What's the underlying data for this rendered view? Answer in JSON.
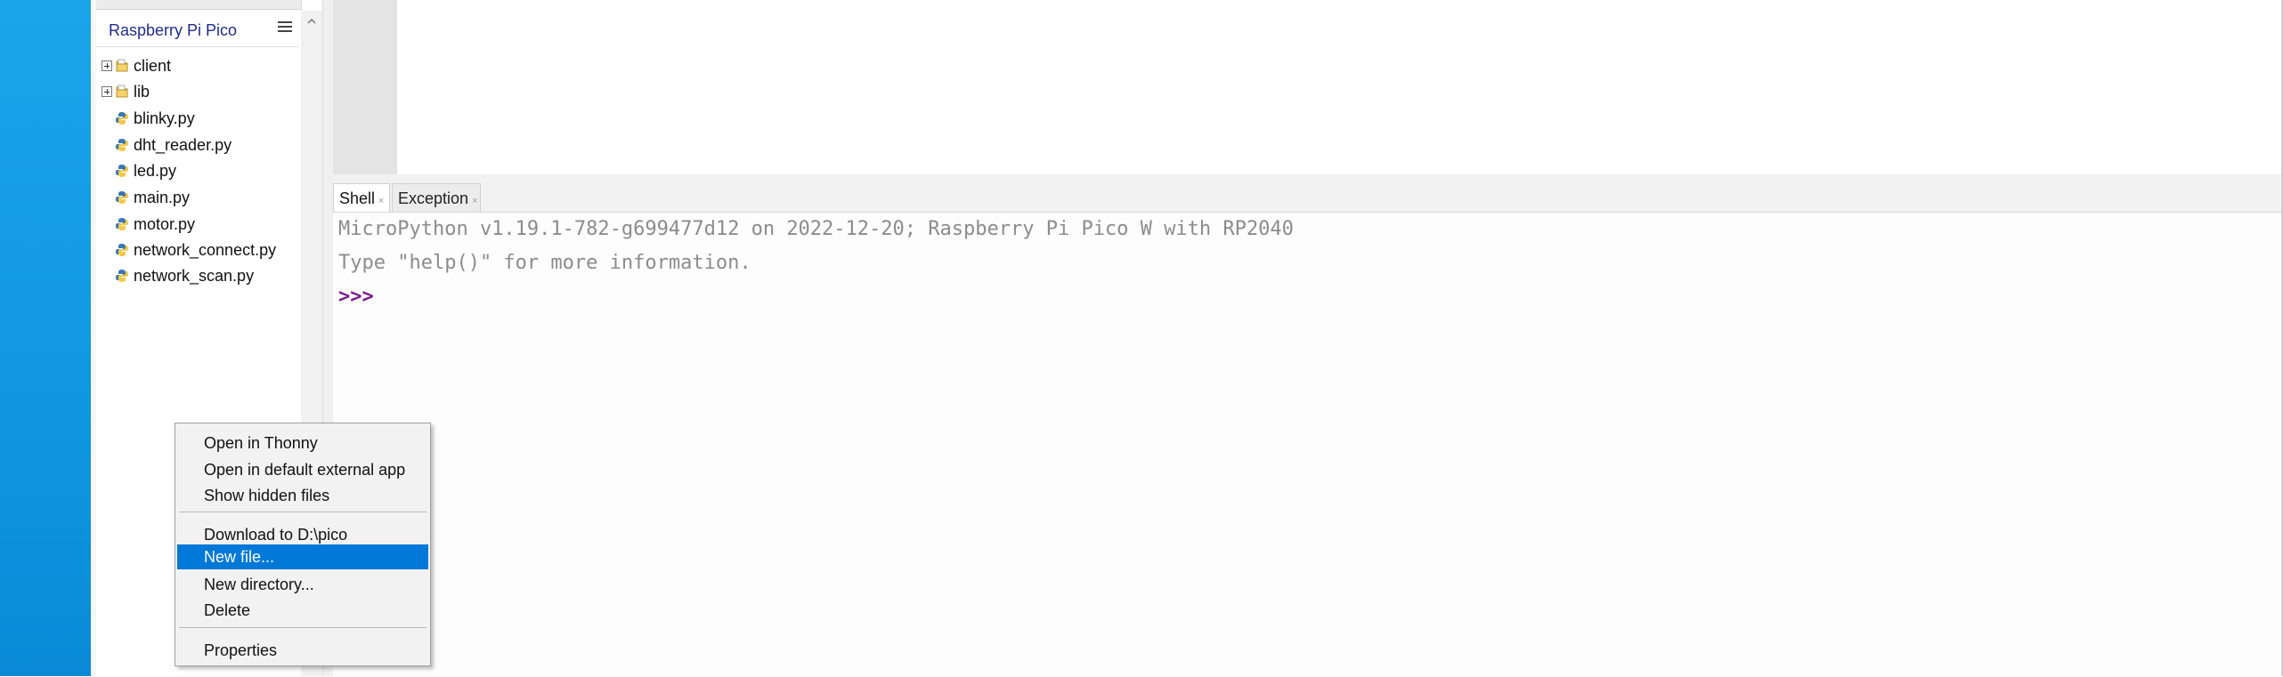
{
  "files": {
    "device_title": "Raspberry Pi Pico",
    "items": [
      {
        "label": "client",
        "type": "folder",
        "expandable": true
      },
      {
        "label": "lib",
        "type": "folder",
        "expandable": true
      },
      {
        "label": "blinky.py",
        "type": "python"
      },
      {
        "label": "dht_reader.py",
        "type": "python"
      },
      {
        "label": "led.py",
        "type": "python"
      },
      {
        "label": "main.py",
        "type": "python"
      },
      {
        "label": "motor.py",
        "type": "python"
      },
      {
        "label": "network_connect.py",
        "type": "python"
      },
      {
        "label": "network_scan.py",
        "type": "python"
      }
    ]
  },
  "tabs": [
    {
      "label": "Shell",
      "active": true
    },
    {
      "label": "Exception",
      "active": false
    }
  ],
  "shell": {
    "lines": [
      "MicroPython v1.19.1-782-g699477d12 on 2022-12-20; Raspberry Pi Pico W with RP2040",
      "Type \"help()\" for more information."
    ],
    "prompt": ">>>"
  },
  "context_menu": {
    "items": [
      "Open in Thonny",
      "Open in default external app",
      "Show hidden files",
      "Download to D:\\pico",
      "New file...",
      "New directory...",
      "Delete",
      "Properties"
    ],
    "selected_index": 4
  },
  "colors": {
    "menu_highlight": "#0078d7",
    "desktop": "#0f97e1",
    "prompt": "#7a1b8c",
    "shell_text": "#8c8c8c",
    "device_title": "#1f2c8a"
  },
  "icons": {
    "folder": "folder-icon",
    "python_file": "python-file-icon",
    "panel_menu": "hamburger-menu-icon",
    "scroll_up": "chevron-up-icon",
    "expand": "plus-box-icon",
    "tab_close": "close-icon"
  }
}
